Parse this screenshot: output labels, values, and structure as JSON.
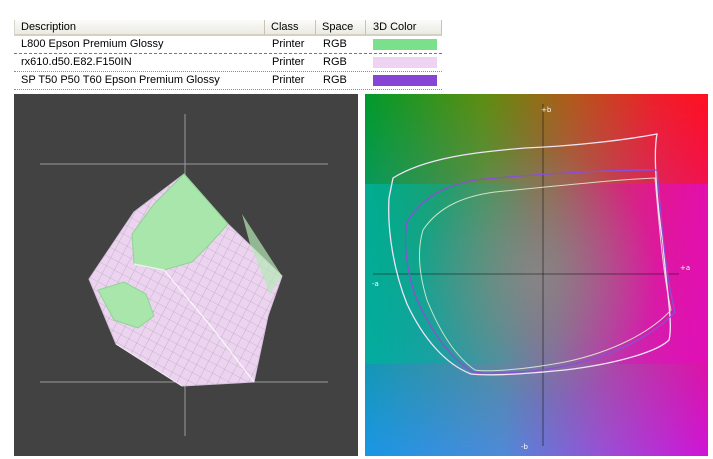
{
  "table": {
    "headers": {
      "description": "Description",
      "class": "Class",
      "space": "Space",
      "color": "3D Color"
    },
    "rows": [
      {
        "description": "L800 Epson Premium Glossy",
        "class": "Printer",
        "space": "RGB",
        "color": "#7be08b"
      },
      {
        "description": "rx610.d50.E82.F150IN",
        "class": "Printer",
        "space": "RGB",
        "color": "#efd3f3"
      },
      {
        "description": "SP T50 P50 T60 Epson Premium Glossy",
        "class": "Printer",
        "space": "RGB",
        "color": "#8645d4"
      }
    ]
  },
  "plot2d": {
    "axes": {
      "plus_b": "+b",
      "minus_b": "-b",
      "plus_a": "+a",
      "minus_a": "-a"
    }
  },
  "colors": {
    "view3d_background": "#424242",
    "gamut_green": "#a9e6ab",
    "gamut_pink": "#ecd4f0",
    "outline_purple": "#8a4fd6",
    "outline_light": "#f2e3f7"
  }
}
